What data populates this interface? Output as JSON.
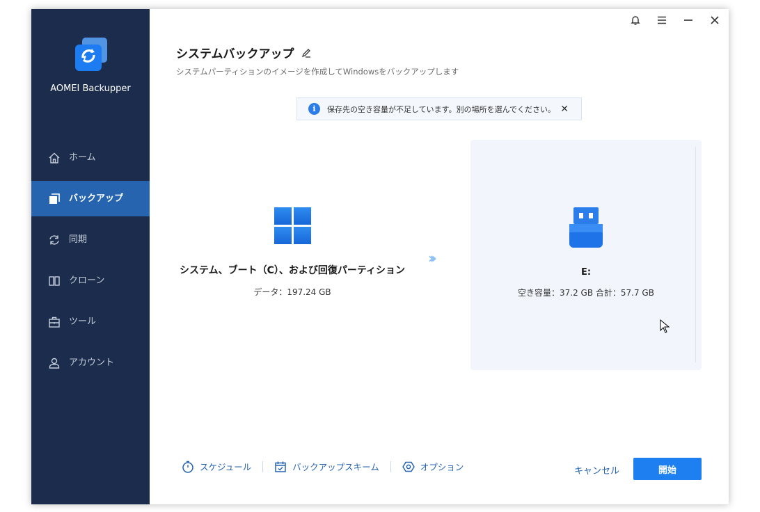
{
  "app": {
    "name": "AOMEI Backupper"
  },
  "sidebar": {
    "items": [
      {
        "label": "ホーム",
        "icon": "home-icon"
      },
      {
        "label": "バックアップ",
        "icon": "backup-icon",
        "active": true
      },
      {
        "label": "同期",
        "icon": "sync-icon"
      },
      {
        "label": "クローン",
        "icon": "clone-icon"
      },
      {
        "label": "ツール",
        "icon": "tools-icon"
      },
      {
        "label": "アカウント",
        "icon": "account-icon"
      }
    ]
  },
  "header": {
    "title": "システムバックアップ",
    "subtitle": "システムパーティションのイメージを作成してWindowsをバックアップします"
  },
  "notice": {
    "text": "保存先の空き容量が不足しています。別の場所を選んでください。"
  },
  "source": {
    "title": "システム、ブート（C）、および回復パーティション",
    "data": "データ：197.24 GB"
  },
  "destination": {
    "name": "E:",
    "space": "空き容量：37.2 GB 合計：57.7 GB"
  },
  "footer": {
    "schedule": "スケジュール",
    "scheme": "バックアップスキーム",
    "options": "オプション",
    "cancel": "キャンセル",
    "start": "開始"
  },
  "colors": {
    "sidebar": "#1b2c4c",
    "active": "#2664b0",
    "accent": "#1d7ff0"
  }
}
